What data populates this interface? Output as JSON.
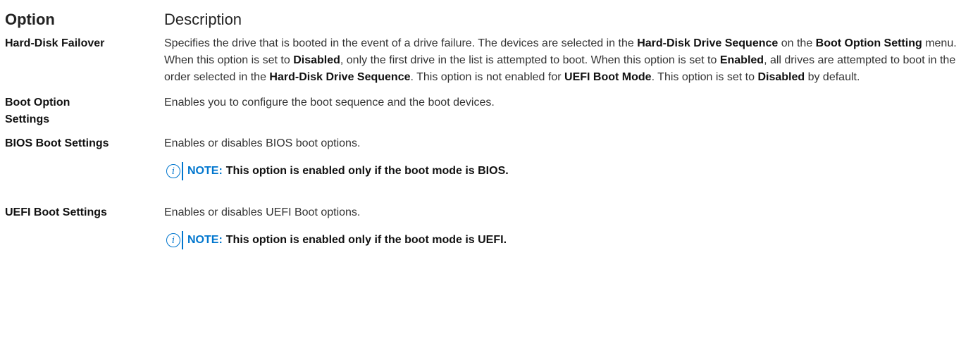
{
  "table": {
    "headers": {
      "option": "Option",
      "description": "Description"
    },
    "rows": [
      {
        "option": "Hard-Disk Failover",
        "description": [
          {
            "t": "Specifies the drive that is booted in the event of a drive failure. The devices are selected in the "
          },
          {
            "t": "Hard-Disk Drive Sequence",
            "b": true
          },
          {
            "t": " on the "
          },
          {
            "t": "Boot Option Setting",
            "b": true
          },
          {
            "t": " menu. When this option is set to "
          },
          {
            "t": "Disabled",
            "b": true
          },
          {
            "t": ", only the first drive in the list is attempted to boot. When this option is set to "
          },
          {
            "t": "Enabled",
            "b": true
          },
          {
            "t": ", all drives are attempted to boot in the order selected in the "
          },
          {
            "t": "Hard-Disk Drive Sequence",
            "b": true
          },
          {
            "t": ". This option is not enabled for "
          },
          {
            "t": "UEFI Boot Mode",
            "b": true
          },
          {
            "t": ". This option is set to "
          },
          {
            "t": "Disabled",
            "b": true
          },
          {
            "t": " by default."
          }
        ]
      },
      {
        "option": "Boot Option Settings",
        "description_text": "Enables you to configure the boot sequence and the boot devices."
      },
      {
        "option": "BIOS Boot Settings",
        "description_text": "Enables or disables BIOS boot options.",
        "note": {
          "label": "NOTE:",
          "text": "This option is enabled only if the boot mode is BIOS."
        }
      },
      {
        "option": "UEFI Boot Settings",
        "description_text": "Enables or disables UEFI Boot options.",
        "note": {
          "label": "NOTE:",
          "text": "This option is enabled only if the boot mode is UEFI."
        }
      }
    ]
  },
  "icons": {
    "note_icon": "info-icon",
    "note_icon_glyph": "i"
  },
  "colors": {
    "accent": "#0076ce",
    "text": "#333333",
    "heading": "#111111"
  }
}
